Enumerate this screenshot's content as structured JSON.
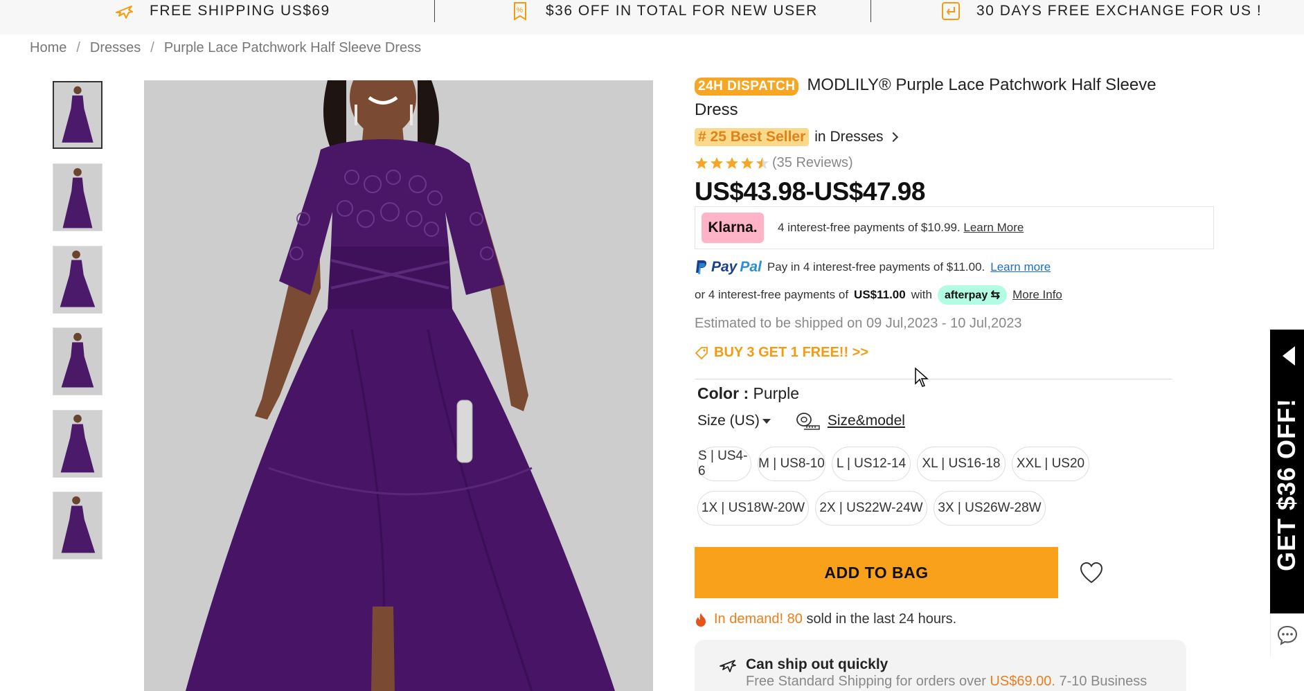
{
  "promo_bar": {
    "items": [
      {
        "icon": "plane-icon",
        "text": "FREE SHIPPING US$69"
      },
      {
        "icon": "percent-tag-icon",
        "text": "$36 OFF IN TOTAL FOR NEW USER"
      },
      {
        "icon": "return-icon",
        "text": "30 DAYS FREE EXCHANGE FOR US !"
      }
    ],
    "icon_color": "#f39c12"
  },
  "breadcrumb": [
    "Home",
    "Dresses",
    "Purple Lace Patchwork Half Sleeve Dress"
  ],
  "product": {
    "dispatch_badge": "24H DISPATCH",
    "title": "MODLILY® Purple Lace Patchwork Half Sleeve Dress",
    "rank_badge": "# 25 Best Seller",
    "rank_category": "in Dresses",
    "rating": 4.5,
    "reviews": "(35 Reviews)",
    "price": "US$43.98-US$47.98"
  },
  "klarna": {
    "logo": "Klarna.",
    "text": "4 interest-free payments of $10.99.",
    "link": "Learn More"
  },
  "paypal": {
    "logo_a": "Pay",
    "logo_b": "Pal",
    "text": "Pay in 4 interest-free payments of $11.00.",
    "link": "Learn more"
  },
  "afterpay": {
    "text_a": "or 4 interest-free payments of",
    "amount": "US$11.00",
    "text_b": "with",
    "logo": "afterpay",
    "link": "More Info"
  },
  "shipping_estimate": "Estimated to be shipped on 09 Jul,2023 - 10 Jul,2023",
  "promo_link": "BUY 3 GET 1 FREE!! >>",
  "color": {
    "label": "Color :",
    "value": "Purple",
    "swatch": "#4b1a6b"
  },
  "size": {
    "label": "Size (US)",
    "guide_link": "Size&model",
    "options": [
      "S | US4-6",
      "M | US8-10",
      "L | US12-14",
      "XL | US16-18",
      "XXL | US20",
      "1X | US18W-20W",
      "2X | US22W-24W",
      "3X | US26W-28W"
    ]
  },
  "add_to_bag": "ADD TO BAG",
  "demand": {
    "hot": "In demand! 80",
    "rest": "sold in the last 24 hours."
  },
  "ship_info": {
    "title": "Can ship out quickly",
    "sub_a": "Free Standard Shipping for orders over",
    "amount": "US$69.00.",
    "sub_b": "7-10 Business"
  },
  "side_promo": "GET $36 OFF!",
  "colors": {
    "accent": "#f9a11b",
    "orange_text": "#f39c12",
    "klarna_pink": "#ffb3c7",
    "afterpay_mint": "#b2fce4",
    "dress_purple": "#4b1a6b"
  }
}
